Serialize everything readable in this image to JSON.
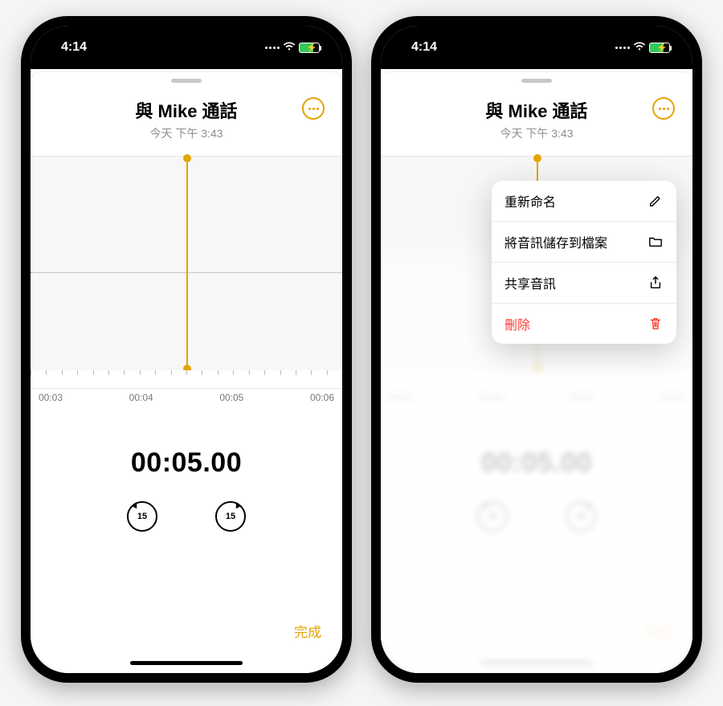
{
  "status": {
    "time": "4:14"
  },
  "recording": {
    "title": "與 Mike 通話",
    "subtitle": "今天 下午 3:43",
    "elapsed": "00:05.00",
    "skip_seconds": "15",
    "scrubber_labels": [
      "00:03",
      "00:04",
      "00:05",
      "00:06"
    ]
  },
  "actions": {
    "done": "完成"
  },
  "menu": {
    "rename": "重新命名",
    "save_to_files": "將音訊儲存到檔案",
    "share": "共享音訊",
    "delete": "刪除"
  }
}
